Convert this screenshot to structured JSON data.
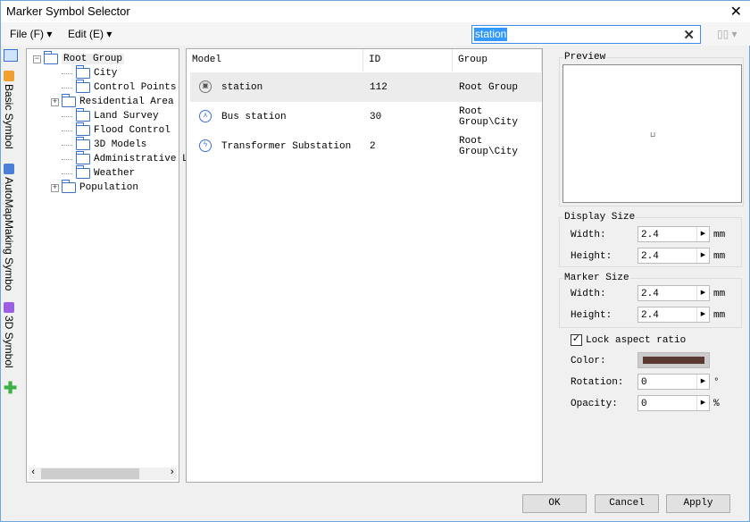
{
  "window": {
    "title": "Marker Symbol Selector"
  },
  "menu": [
    {
      "label": "File (F)"
    },
    {
      "label": "Edit (E)"
    }
  ],
  "search": {
    "value": "station"
  },
  "vtabs": [
    {
      "label": "Basic Symbol"
    },
    {
      "label": "AutoMapMaking Symbo"
    },
    {
      "label": "3D Symbol"
    }
  ],
  "tree": {
    "root": "Root Group",
    "children": [
      "City",
      "Control Points",
      "Residential Area",
      "Land Survey",
      "Flood Control",
      "3D Models",
      "Administrative Lev",
      "Weather",
      "Population"
    ]
  },
  "list": {
    "columns": [
      "Model",
      "ID",
      "Group"
    ],
    "rows": [
      {
        "model": "station",
        "id": "112",
        "group": "Root Group",
        "icon": "bus-icon"
      },
      {
        "model": "Bus station",
        "id": "30",
        "group": "Root Group\\City",
        "icon": "bus-station-icon"
      },
      {
        "model": "Transformer Substation",
        "id": "2",
        "group": "Root Group\\City",
        "icon": "lightning-icon"
      }
    ]
  },
  "panel": {
    "preview": "Preview",
    "display_size": {
      "title": "Display Size",
      "width_label": "Width:",
      "width": "2.4",
      "height_label": "Height:",
      "height": "2.4",
      "unit": "mm"
    },
    "marker_size": {
      "title": "Marker Size",
      "width_label": "Width:",
      "width": "2.4",
      "height_label": "Height:",
      "height": "2.4",
      "unit": "mm"
    },
    "lock": {
      "label": "Lock aspect ratio",
      "checked": true
    },
    "color_label": "Color:",
    "color": "#5a3a30",
    "rotation_label": "Rotation:",
    "rotation": "0",
    "rotation_unit": "°",
    "opacity_label": "Opacity:",
    "opacity": "0",
    "opacity_unit": "%"
  },
  "buttons": {
    "ok": "OK",
    "cancel": "Cancel",
    "apply": "Apply"
  }
}
